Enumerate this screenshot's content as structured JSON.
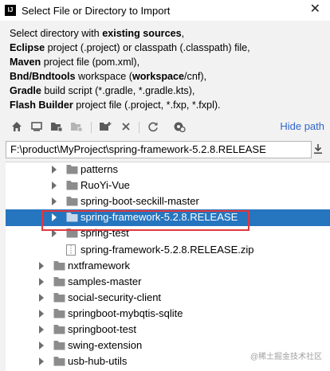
{
  "window": {
    "title": "Select File or Directory to Import",
    "close_symbol": "✕",
    "app_icon_text": "IJ"
  },
  "description": {
    "intro": "Select directory with ",
    "intro_bold": "existing sources",
    "intro_end": ",",
    "lines": [
      {
        "bold": "Eclipse",
        "text": " project (.project) or classpath (.classpath) file,"
      },
      {
        "bold": "Maven",
        "text": " project file (pom.xml),"
      },
      {
        "bold": "Bnd/Bndtools",
        "text": " workspace (",
        "bold2": "workspace",
        "text2": "/cnf),"
      },
      {
        "bold": "Gradle",
        "text": " build script (*.gradle, *.gradle.kts),"
      },
      {
        "bold": "Flash Builder",
        "text": " project file (.project, *.fxp, *.fxpl)."
      }
    ]
  },
  "toolbar": {
    "icons": [
      "home-icon",
      "desktop-icon",
      "project-folder-icon",
      "module-folder-icon",
      "new-folder-icon",
      "delete-icon",
      "refresh-icon",
      "show-hidden-icon"
    ],
    "hide_path_label": "Hide path"
  },
  "path": {
    "value": "F:\\product\\MyProject\\spring-framework-5.2.8.RELEASE"
  },
  "tree": {
    "items": [
      {
        "label": "patterns",
        "level": 2,
        "expandable": true,
        "type": "folder"
      },
      {
        "label": "RuoYi-Vue",
        "level": 2,
        "expandable": true,
        "type": "folder"
      },
      {
        "label": "spring-boot-seckill-master",
        "level": 2,
        "expandable": true,
        "type": "folder"
      },
      {
        "label": "spring-framework-5.2.8.RELEASE",
        "level": 2,
        "expandable": true,
        "type": "folder",
        "selected": true
      },
      {
        "label": "spring-test",
        "level": 2,
        "expandable": true,
        "type": "folder"
      },
      {
        "label": "spring-framework-5.2.8.RELEASE.zip",
        "level": 2,
        "expandable": false,
        "type": "zip"
      },
      {
        "label": "nxtframework",
        "level": 1,
        "expandable": true,
        "type": "folder"
      },
      {
        "label": "samples-master",
        "level": 1,
        "expandable": true,
        "type": "folder"
      },
      {
        "label": "social-security-client",
        "level": 1,
        "expandable": true,
        "type": "folder"
      },
      {
        "label": "springboot-mybqtis-sqlite",
        "level": 1,
        "expandable": true,
        "type": "folder"
      },
      {
        "label": "springboot-test",
        "level": 1,
        "expandable": true,
        "type": "folder"
      },
      {
        "label": "swing-extension",
        "level": 1,
        "expandable": true,
        "type": "folder"
      },
      {
        "label": "usb-hub-utils",
        "level": 1,
        "expandable": true,
        "type": "folder"
      }
    ]
  },
  "watermark": "@稀土掘金技术社区",
  "colors": {
    "selection": "#2675bf",
    "link": "#2f65ca",
    "highlight_box": "#e0383e",
    "folder": "#8c8c8c"
  }
}
